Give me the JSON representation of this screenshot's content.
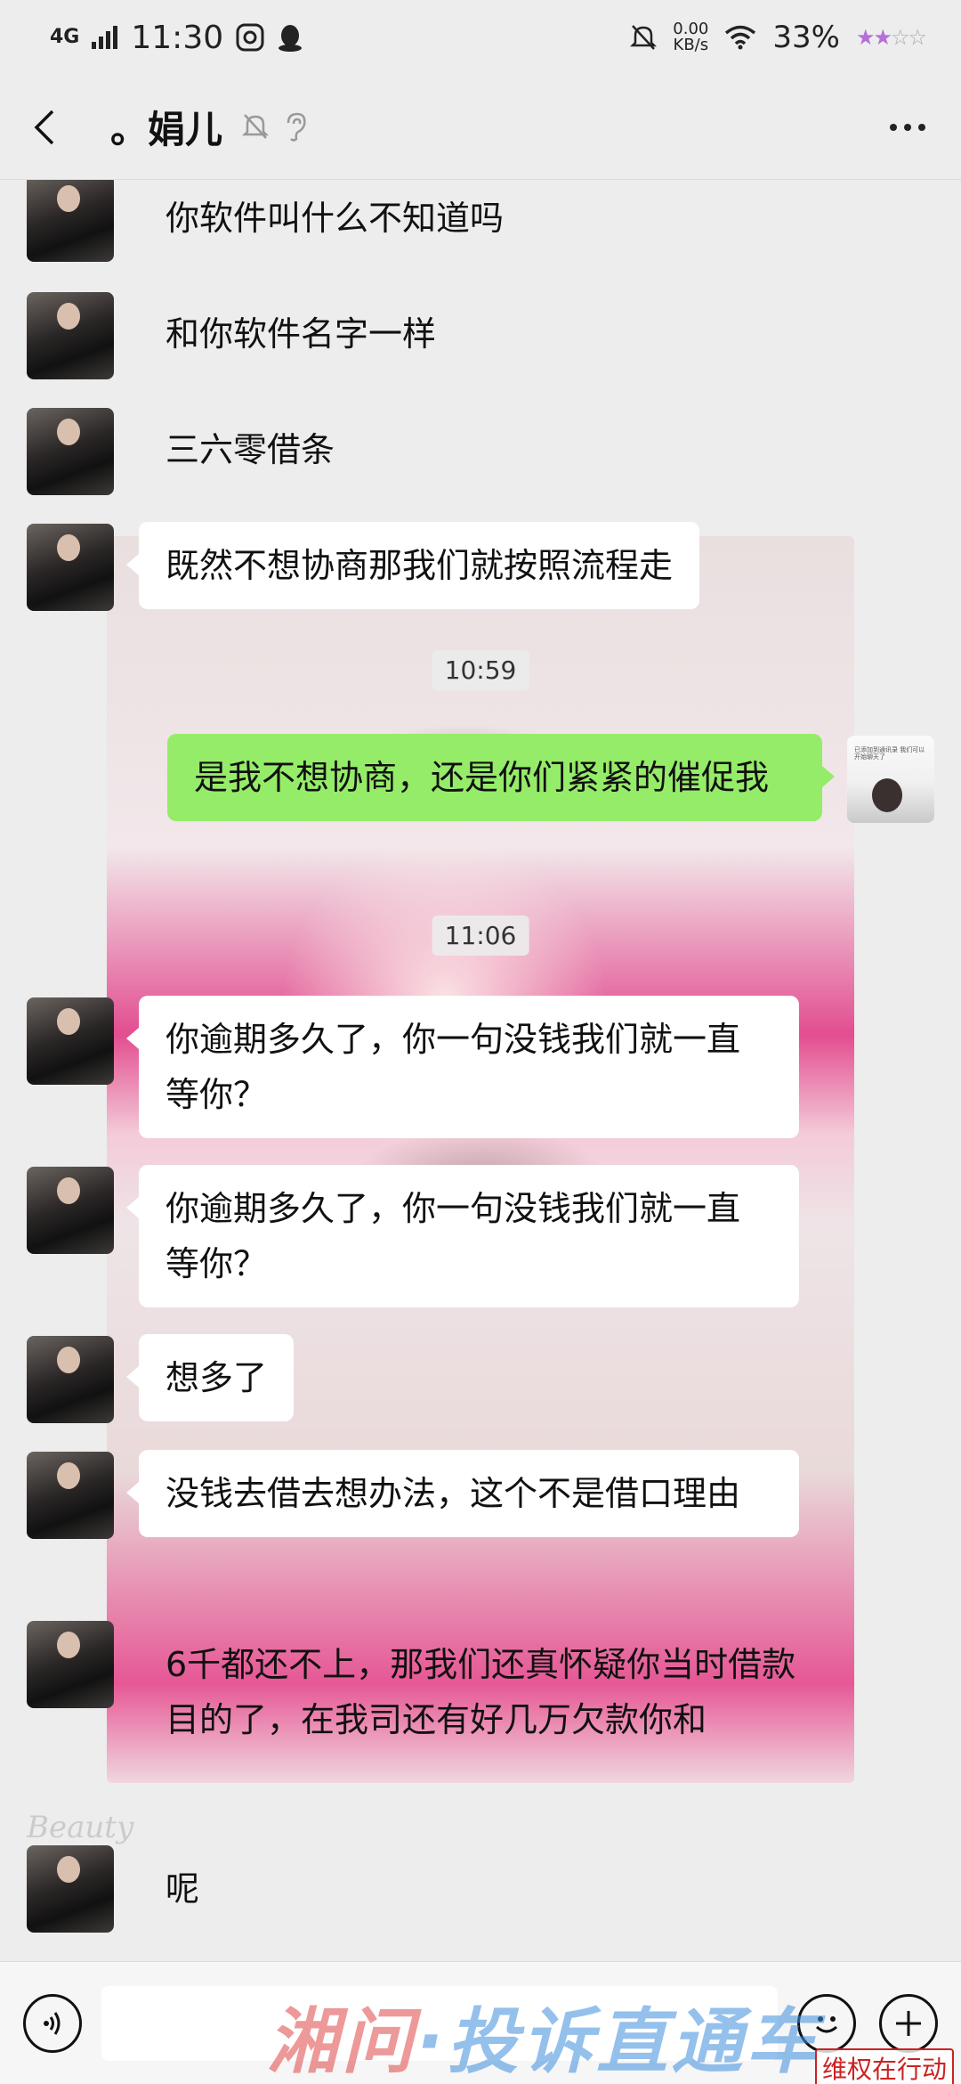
{
  "status_bar": {
    "network": "4G",
    "time": "11:30",
    "speed_value": "0.00",
    "speed_unit": "KB/s",
    "battery": "33%"
  },
  "header": {
    "title": "。娟儿",
    "back_icon": "chevron-left-icon",
    "mute_icon": "bell-off-icon",
    "earpiece_icon": "ear-icon",
    "more_icon": "more-dots-icon"
  },
  "messages": [
    {
      "side": "in",
      "text": "你软件叫什么不知道吗",
      "bubble": false
    },
    {
      "side": "in",
      "text": "和你软件名字一样",
      "bubble": false
    },
    {
      "side": "in",
      "text": "三六零借条",
      "bubble": false
    },
    {
      "side": "in",
      "text": "既然不想协商那我们就按照流程走",
      "bubble": true
    },
    {
      "timestamp": "10:59"
    },
    {
      "side": "out",
      "text": "是我不想协商，还是你们紧紧的催促我",
      "bubble": true
    },
    {
      "timestamp": "11:06"
    },
    {
      "side": "in",
      "text": "你逾期多久了，你一句没钱我们就一直等你？",
      "bubble": true
    },
    {
      "side": "in",
      "text": "你逾期多久了，你一句没钱我们就一直等你？",
      "bubble": true
    },
    {
      "side": "in",
      "text": "想多了",
      "bubble": true
    },
    {
      "side": "in",
      "text": "没钱去借去想办法，这个不是借口理由",
      "bubble": true
    },
    {
      "side": "in",
      "text": "6千都还不上，那我们还真怀疑你当时借款目的了，在我司还有好几万欠款你和",
      "bubble": false
    },
    {
      "side": "in",
      "text": "呢",
      "bubble": false
    }
  ],
  "my_avatar_caption": "已添加到通讯录 我们可以开始聊天了",
  "input_bar": {
    "voice_icon": "voice-icon",
    "emoji_icon": "emoji-icon",
    "plus_icon": "plus-icon"
  },
  "watermark": {
    "part1": "湘问",
    "part2": "·投诉直通车",
    "corner": "维权在行动",
    "signature": "Beauty"
  },
  "colors": {
    "background": "#ededed",
    "incoming_bubble": "#ffffff",
    "outgoing_bubble": "#95ec69"
  }
}
